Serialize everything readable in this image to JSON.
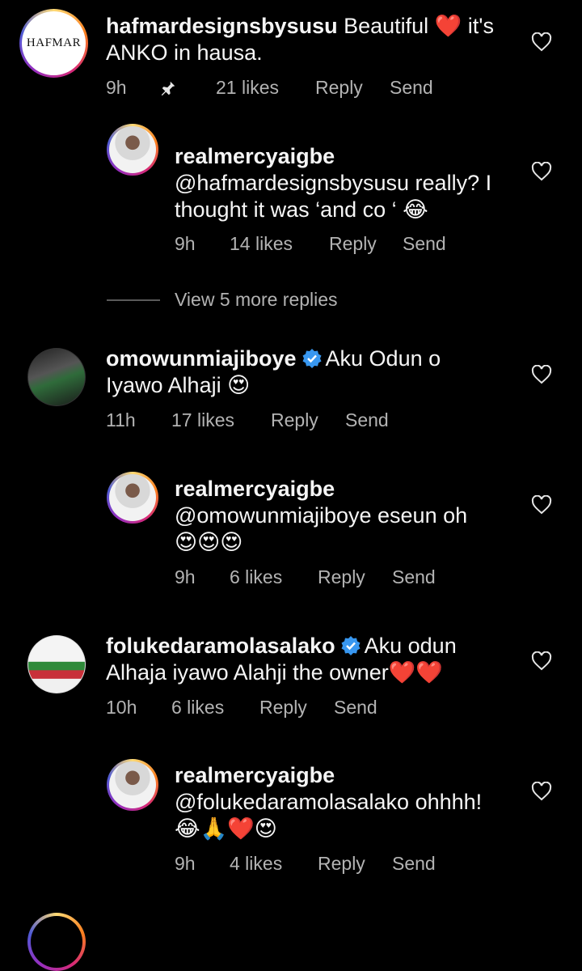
{
  "comments": [
    {
      "username": "hafmardesignsbysusu",
      "text_line1": "Beautiful ❤️ it's",
      "text_line2": "ANKO in hausa.",
      "time": "9h",
      "likes": "21 likes",
      "reply": "Reply",
      "send": "Send",
      "avatar_text": "HAFMAR"
    },
    {
      "username": "realmercyaigbe",
      "text_line1": "@hafmardesignsbysusu really?  I",
      "text_line2": "thought it was ‘and co ‘ 😂",
      "time": "9h",
      "likes": "14 likes",
      "reply": "Reply",
      "send": "Send"
    },
    {
      "username": "omowunmiajiboye",
      "text_line1": "Aku Odun o",
      "text_line2": "Iyawo Alhaji 😍",
      "time": "11h",
      "likes": "17 likes",
      "reply": "Reply",
      "send": "Send"
    },
    {
      "username": "realmercyaigbe",
      "text_line1": "@omowunmiajiboye eseun oh",
      "text_line2": "😍😍😍",
      "time": "9h",
      "likes": "6 likes",
      "reply": "Reply",
      "send": "Send"
    },
    {
      "username": "folukedaramolasalako",
      "text_line1": "Aku odun",
      "text_line2": "Alhaja iyawo Alahji the owner❤️❤️",
      "time": "10h",
      "likes": "6 likes",
      "reply": "Reply",
      "send": "Send"
    },
    {
      "username": "realmercyaigbe",
      "text_line1": "@folukedaramolasalako ohhhh!",
      "text_line2": "😂🙏❤️😍",
      "time": "9h",
      "likes": "4 likes",
      "reply": "Reply",
      "send": "Send"
    }
  ],
  "view_more": "View 5 more replies",
  "icons": {
    "like": "heart-outline-icon",
    "pin": "pin-icon",
    "verified": "verified-badge-icon"
  },
  "colors": {
    "background": "#000000",
    "text": "#f5f5f5",
    "meta": "#b3b3b3",
    "verified": "#3897f0"
  }
}
